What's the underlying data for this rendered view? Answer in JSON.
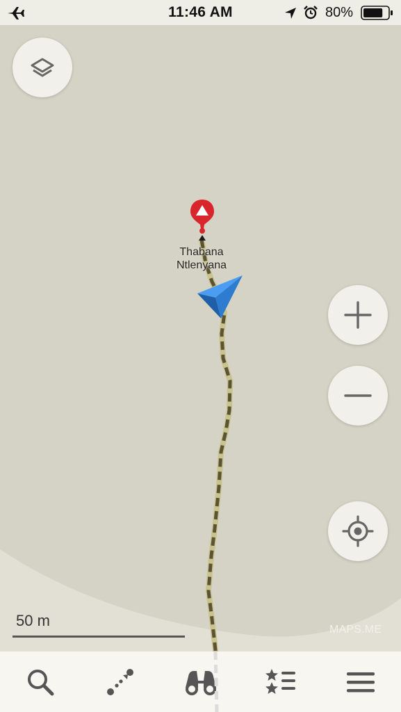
{
  "status_bar": {
    "time": "11:46 AM",
    "battery_percent": "80%",
    "battery_level": 0.8,
    "icons": [
      "airplane-icon",
      "location-arrow-icon",
      "alarm-icon",
      "battery-icon"
    ]
  },
  "map": {
    "poi": {
      "label": "Thabana\nNtlenyana",
      "icon": "mountain-peak-pin-icon"
    },
    "scale_label": "50 m",
    "copyright": "MAPS.ME",
    "colors": {
      "land": "#d5d3c5",
      "land_light": "#e3e1d6",
      "trail": "#5a5132",
      "trail_highlight": "#c7c290",
      "pin": "#d8262c",
      "position_arrow": "#3a8de0"
    }
  },
  "controls": {
    "layers_icon": "layers-icon",
    "zoom_in_icon": "plus-icon",
    "zoom_out_icon": "minus-icon",
    "my_location_icon": "crosshair-icon"
  },
  "toolbar": {
    "items": [
      {
        "icon": "search-icon"
      },
      {
        "icon": "route-icon"
      },
      {
        "icon": "binoculars-icon"
      },
      {
        "icon": "bookmarks-list-icon"
      },
      {
        "icon": "menu-icon"
      }
    ]
  }
}
